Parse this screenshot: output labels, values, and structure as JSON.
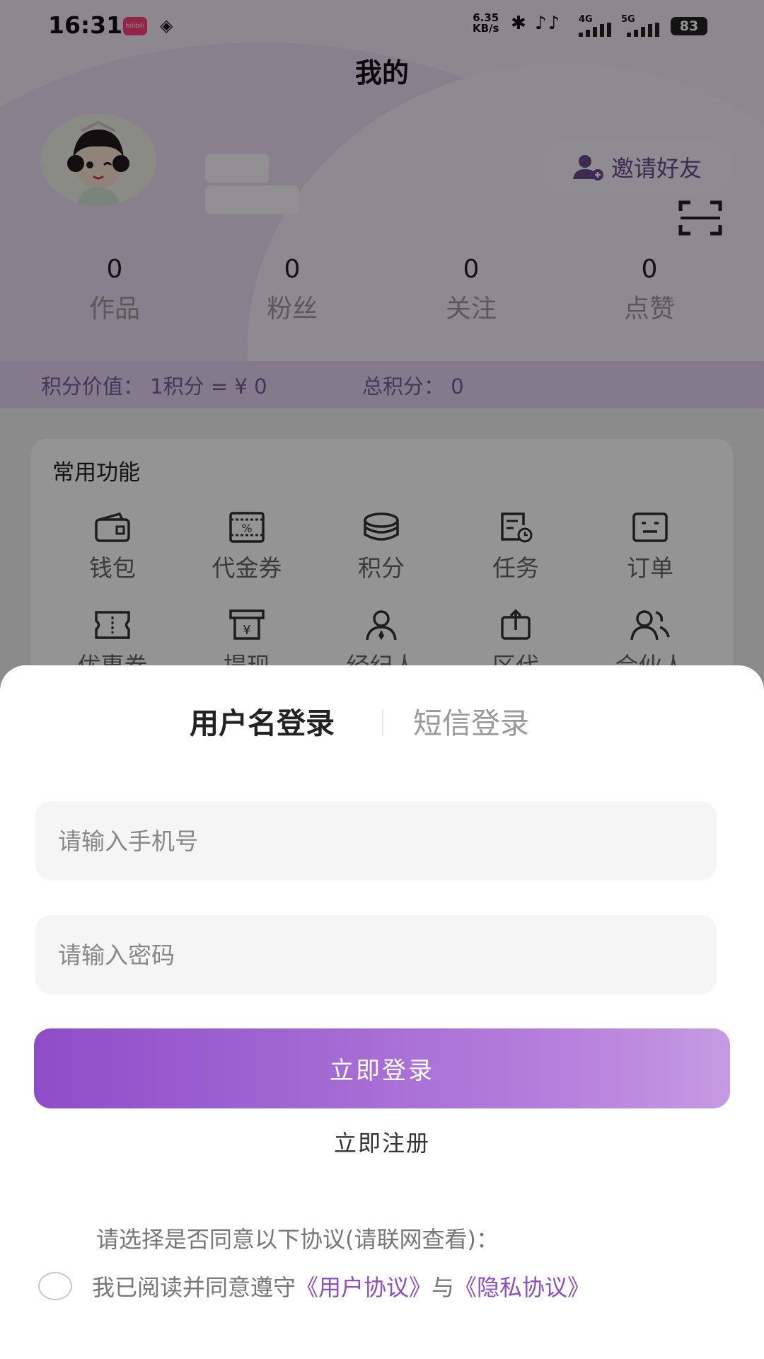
{
  "status_bar": {
    "time": "16:31",
    "app_badge": "bilibili",
    "net_speed_value": "6.35",
    "net_speed_unit": "KB/s",
    "signal_4g": "4G",
    "signal_5g": "5G",
    "battery": "83"
  },
  "page": {
    "title": "我的",
    "invite_label": "邀请好友"
  },
  "stats": [
    {
      "value": "0",
      "label": "作品"
    },
    {
      "value": "0",
      "label": "粉丝"
    },
    {
      "value": "0",
      "label": "关注"
    },
    {
      "value": "0",
      "label": "点赞"
    }
  ],
  "points": {
    "value_text": "积分价值：  1积分 = ¥ 0",
    "total_text": "总积分：  0"
  },
  "functions": {
    "title": "常用功能",
    "items": [
      {
        "label": "钱包",
        "icon": "wallet-icon"
      },
      {
        "label": "代金券",
        "icon": "voucher-icon"
      },
      {
        "label": "积分",
        "icon": "coins-icon"
      },
      {
        "label": "任务",
        "icon": "task-icon"
      },
      {
        "label": "订单",
        "icon": "order-icon"
      },
      {
        "label": "优惠券",
        "icon": "coupon-icon"
      },
      {
        "label": "提现",
        "icon": "withdraw-icon"
      },
      {
        "label": "经纪人",
        "icon": "agent-icon"
      },
      {
        "label": "区代",
        "icon": "region-agent-icon"
      },
      {
        "label": "合伙人",
        "icon": "partner-icon"
      }
    ]
  },
  "login": {
    "tab_username": "用户名登录",
    "tab_sms": "短信登录",
    "phone_placeholder": "请输入手机号",
    "password_placeholder": "请输入密码",
    "login_button": "立即登录",
    "register_link": "立即注册",
    "agreement_hint": "请选择是否同意以下协议(请联网查看)：",
    "agreement_prefix": "我已阅读并同意遵守",
    "user_agreement": "《用户协议》",
    "connector": "与",
    "privacy_agreement": "《隐私协议》"
  },
  "colors": {
    "accent": "#8a4fc2",
    "button_gradient_start": "#8e4dc8",
    "button_gradient_end": "#c69ae2",
    "points_bar": "#e3d3ef"
  }
}
